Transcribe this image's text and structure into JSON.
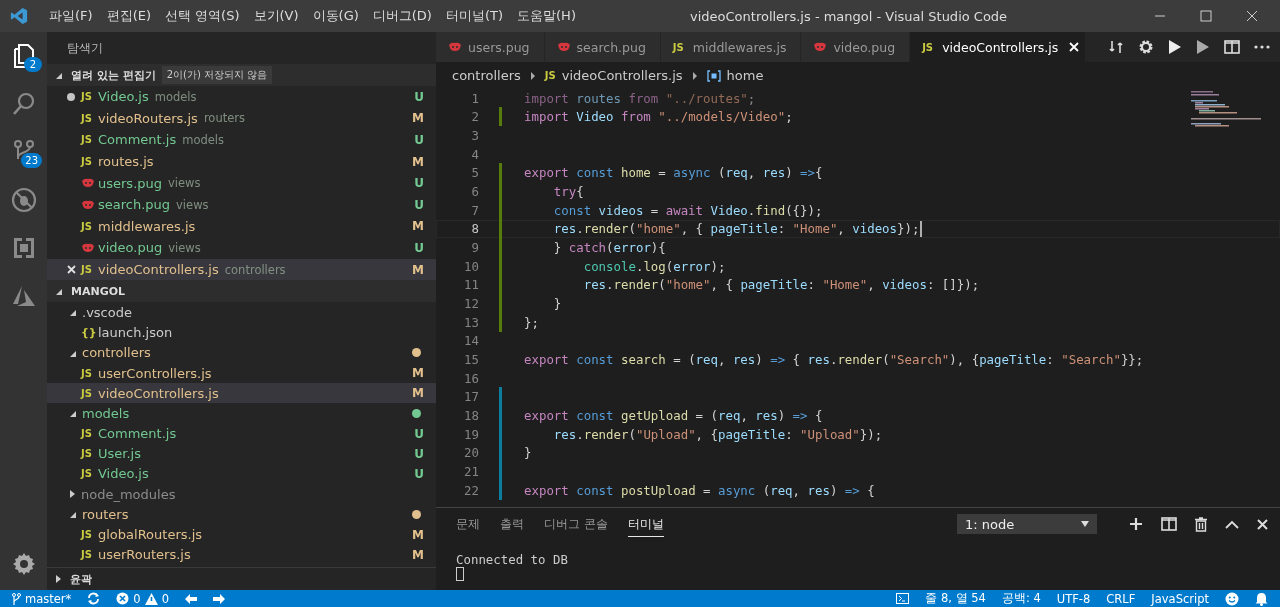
{
  "title_bar": {
    "menu": [
      "파일(F)",
      "편집(E)",
      "선택 영역(S)",
      "보기(V)",
      "이동(G)",
      "디버그(D)",
      "터미널(T)",
      "도움말(H)"
    ],
    "title": "videoControllers.js - mangol - Visual Studio Code"
  },
  "activity_bar": {
    "items": [
      {
        "kind": "files",
        "badge": "2",
        "selected": true
      },
      {
        "kind": "search",
        "selected": false
      },
      {
        "kind": "source-control",
        "badge": "23",
        "selected": false
      },
      {
        "kind": "debug",
        "selected": false
      },
      {
        "kind": "extensions",
        "selected": false
      },
      {
        "kind": "azure",
        "selected": false
      }
    ]
  },
  "sidebar": {
    "title": "탐색기",
    "open_editors": {
      "title": "열려 있는 편집기",
      "expanded": true,
      "note": "2이(가) 저장되지 않음",
      "items": [
        {
          "name": "Video.js",
          "folder": "models",
          "kind": "js",
          "icon_label": "JS",
          "color": "#73c991",
          "status": "U",
          "dirty": true,
          "selected": false
        },
        {
          "name": "videoRouters.js",
          "folder": "routers",
          "kind": "js",
          "icon_label": "JS",
          "color": "#e2c08d",
          "status": "M",
          "dirty": false,
          "selected": false
        },
        {
          "name": "Comment.js",
          "folder": "models",
          "kind": "js",
          "icon_label": "JS",
          "color": "#73c991",
          "status": "U",
          "dirty": false,
          "selected": false
        },
        {
          "name": "routes.js",
          "kind": "js",
          "icon_label": "JS",
          "color": "#e2c08d",
          "status": "M",
          "dirty": false,
          "selected": false
        },
        {
          "name": "users.pug",
          "folder": "views",
          "kind": "pug",
          "color": "#73c991",
          "status": "U",
          "dirty": false,
          "selected": false
        },
        {
          "name": "search.pug",
          "folder": "views",
          "kind": "pug",
          "color": "#73c991",
          "status": "U",
          "dirty": false,
          "selected": false
        },
        {
          "name": "middlewares.js",
          "kind": "js",
          "icon_label": "JS",
          "color": "#e2c08d",
          "status": "M",
          "dirty": false,
          "selected": false
        },
        {
          "name": "video.pug",
          "folder": "views",
          "kind": "pug",
          "color": "#73c991",
          "status": "U",
          "dirty": false,
          "selected": false
        },
        {
          "name": "videoControllers.js",
          "folder": "controllers",
          "kind": "js",
          "icon_label": "JS",
          "color": "#e2c08d",
          "status": "M",
          "dirty": false,
          "selected": true
        }
      ]
    },
    "workspace": {
      "title": "MANGOL",
      "expanded": true,
      "children": [
        {
          "name": ".vscode",
          "kind": "folder",
          "expanded": true,
          "color": "#cccccc",
          "status_dot": false,
          "children": [
            {
              "name": "launch.json",
              "kind": "json",
              "icon_label": "{}",
              "color": "#cccccc",
              "selected": false
            }
          ]
        },
        {
          "name": "controllers",
          "kind": "folder",
          "expanded": true,
          "color": "#e2c08d",
          "status_dot": true,
          "children": [
            {
              "name": "userControllers.js",
              "kind": "js",
              "icon_label": "JS",
              "color": "#e2c08d",
              "status": "M",
              "selected": false
            },
            {
              "name": "videoControllers.js",
              "kind": "js",
              "icon_label": "JS",
              "color": "#e2c08d",
              "status": "M",
              "selected": true
            }
          ]
        },
        {
          "name": "models",
          "kind": "folder",
          "expanded": true,
          "color": "#73c991",
          "status_dot": true,
          "children": [
            {
              "name": "Comment.js",
              "kind": "js",
              "icon_label": "JS",
              "color": "#73c991",
              "status": "U",
              "selected": false
            },
            {
              "name": "User.js",
              "kind": "js",
              "icon_label": "JS",
              "color": "#73c991",
              "status": "U",
              "selected": false
            },
            {
              "name": "Video.js",
              "kind": "js",
              "icon_label": "JS",
              "color": "#73c991",
              "status": "U",
              "selected": false
            }
          ]
        },
        {
          "name": "node_modules",
          "kind": "folder",
          "expanded": false,
          "color": "#8c8c8c",
          "status_dot": false
        },
        {
          "name": "routers",
          "kind": "folder",
          "expanded": true,
          "color": "#e2c08d",
          "status_dot": true,
          "children": [
            {
              "name": "globalRouters.js",
              "kind": "js",
              "icon_label": "JS",
              "color": "#e2c08d",
              "status": "M",
              "selected": false
            },
            {
              "name": "userRouters.js",
              "kind": "js",
              "icon_label": "JS",
              "color": "#e2c08d",
              "status": "M",
              "selected": false
            }
          ]
        }
      ]
    },
    "outline": {
      "title": "윤곽",
      "expanded": false
    }
  },
  "editor": {
    "tabs": [
      {
        "label": "users.pug",
        "kind": "pug",
        "selected": false
      },
      {
        "label": "search.pug",
        "kind": "pug",
        "selected": false
      },
      {
        "label": "middlewares.js",
        "kind": "js",
        "icon_label": "JS",
        "selected": false
      },
      {
        "label": "video.pug",
        "kind": "pug",
        "selected": false
      },
      {
        "label": "videoControllers.js",
        "kind": "js",
        "icon_label": "JS",
        "selected": true
      }
    ],
    "breadcrumb": {
      "folder": "controllers",
      "file": "videoControllers.js",
      "file_icon_label": "JS",
      "symbol": "home"
    },
    "lines": [
      {
        "number": "1",
        "faded": true,
        "tokens": [
          {
            "text": "import",
            "kind": "kw"
          },
          {
            "text": " routes",
            "kind": "var"
          },
          {
            "text": " from",
            "kind": "kw"
          },
          {
            "text": " \"../routes\"",
            "kind": "str"
          },
          {
            "text": ";",
            "kind": "p"
          }
        ]
      },
      {
        "number": "2",
        "kind": "added",
        "tokens": [
          {
            "text": "import",
            "kind": "kw"
          },
          {
            "text": " Video",
            "kind": "var"
          },
          {
            "text": " from",
            "kind": "kw"
          },
          {
            "text": " \"../models/Video\"",
            "kind": "str"
          },
          {
            "text": ";",
            "kind": "p"
          }
        ]
      },
      {
        "number": "3"
      },
      {
        "number": "4"
      },
      {
        "number": "5",
        "kind": "added",
        "tokens": [
          {
            "text": "export",
            "kind": "kw"
          },
          {
            "text": " const",
            "kind": "st"
          },
          {
            "text": " home",
            "kind": "fn"
          },
          {
            "text": " =",
            "kind": "p"
          },
          {
            "text": " async",
            "kind": "st"
          },
          {
            "text": " (",
            "kind": "p"
          },
          {
            "text": "req",
            "kind": "var"
          },
          {
            "text": ", ",
            "kind": "p"
          },
          {
            "text": "res",
            "kind": "var"
          },
          {
            "text": ") ",
            "kind": "p"
          },
          {
            "text": "=>",
            "kind": "st"
          },
          {
            "text": "{",
            "kind": "p"
          }
        ]
      },
      {
        "number": "6",
        "kind": "added",
        "tokens": [
          {
            "text": "    try",
            "kind": "kw"
          },
          {
            "text": "{",
            "kind": "p"
          }
        ]
      },
      {
        "number": "7",
        "kind": "added",
        "tokens": [
          {
            "text": "    const",
            "kind": "st"
          },
          {
            "text": " videos",
            "kind": "var"
          },
          {
            "text": " =",
            "kind": "p"
          },
          {
            "text": " await",
            "kind": "kw"
          },
          {
            "text": " Video",
            "kind": "var"
          },
          {
            "text": ".",
            "kind": "p"
          },
          {
            "text": "find",
            "kind": "fn"
          },
          {
            "text": "({});",
            "kind": "p"
          }
        ]
      },
      {
        "number": "8",
        "kind": "added",
        "current": true,
        "tokens": [
          {
            "text": "    res",
            "kind": "var"
          },
          {
            "text": ".",
            "kind": "p"
          },
          {
            "text": "render",
            "kind": "fn"
          },
          {
            "text": "(",
            "kind": "p"
          },
          {
            "text": "\"home\"",
            "kind": "str"
          },
          {
            "text": ", { ",
            "kind": "p"
          },
          {
            "text": "pageTitle",
            "kind": "var"
          },
          {
            "text": ": ",
            "kind": "p"
          },
          {
            "text": "\"Home\"",
            "kind": "str"
          },
          {
            "text": ", ",
            "kind": "p"
          },
          {
            "text": "videos",
            "kind": "var"
          },
          {
            "text": "});",
            "kind": "p"
          }
        ]
      },
      {
        "number": "9",
        "kind": "added",
        "tokens": [
          {
            "text": "    } ",
            "kind": "p"
          },
          {
            "text": "catch",
            "kind": "kw"
          },
          {
            "text": "(",
            "kind": "p"
          },
          {
            "text": "error",
            "kind": "var"
          },
          {
            "text": "){",
            "kind": "p"
          }
        ]
      },
      {
        "number": "10",
        "kind": "added",
        "tokens": [
          {
            "text": "        console",
            "kind": "cls"
          },
          {
            "text": ".",
            "kind": "p"
          },
          {
            "text": "log",
            "kind": "fn"
          },
          {
            "text": "(",
            "kind": "p"
          },
          {
            "text": "error",
            "kind": "var"
          },
          {
            "text": ");",
            "kind": "p"
          }
        ]
      },
      {
        "number": "11",
        "kind": "added",
        "tokens": [
          {
            "text": "        res",
            "kind": "var"
          },
          {
            "text": ".",
            "kind": "p"
          },
          {
            "text": "render",
            "kind": "fn"
          },
          {
            "text": "(",
            "kind": "p"
          },
          {
            "text": "\"home\"",
            "kind": "str"
          },
          {
            "text": ", { ",
            "kind": "p"
          },
          {
            "text": "pageTitle",
            "kind": "var"
          },
          {
            "text": ": ",
            "kind": "p"
          },
          {
            "text": "\"Home\"",
            "kind": "str"
          },
          {
            "text": ", ",
            "kind": "p"
          },
          {
            "text": "videos",
            "kind": "var"
          },
          {
            "text": ": []});",
            "kind": "p"
          }
        ]
      },
      {
        "number": "12",
        "kind": "added",
        "tokens": [
          {
            "text": "    }",
            "kind": "p"
          }
        ]
      },
      {
        "number": "13",
        "kind": "added",
        "tokens": [
          {
            "text": "};",
            "kind": "p"
          }
        ]
      },
      {
        "number": "14"
      },
      {
        "number": "15",
        "tokens": [
          {
            "text": "export",
            "kind": "kw"
          },
          {
            "text": " const",
            "kind": "st"
          },
          {
            "text": " search",
            "kind": "fn"
          },
          {
            "text": " = (",
            "kind": "p"
          },
          {
            "text": "req",
            "kind": "var"
          },
          {
            "text": ", ",
            "kind": "p"
          },
          {
            "text": "res",
            "kind": "var"
          },
          {
            "text": ") ",
            "kind": "p"
          },
          {
            "text": "=>",
            "kind": "st"
          },
          {
            "text": " { ",
            "kind": "p"
          },
          {
            "text": "res",
            "kind": "var"
          },
          {
            "text": ".",
            "kind": "p"
          },
          {
            "text": "render",
            "kind": "fn"
          },
          {
            "text": "(",
            "kind": "p"
          },
          {
            "text": "\"Search\"",
            "kind": "str"
          },
          {
            "text": "), {",
            "kind": "p"
          },
          {
            "text": "pageTitle",
            "kind": "var"
          },
          {
            "text": ": ",
            "kind": "p"
          },
          {
            "text": "\"Search\"",
            "kind": "str"
          },
          {
            "text": "}};",
            "kind": "p"
          }
        ]
      },
      {
        "number": "16"
      },
      {
        "number": "17",
        "kind": "modified"
      },
      {
        "number": "18",
        "kind": "modified",
        "tokens": [
          {
            "text": "export",
            "kind": "kw"
          },
          {
            "text": " const",
            "kind": "st"
          },
          {
            "text": " getUpload",
            "kind": "fn"
          },
          {
            "text": " = (",
            "kind": "p"
          },
          {
            "text": "req",
            "kind": "var"
          },
          {
            "text": ", ",
            "kind": "p"
          },
          {
            "text": "res",
            "kind": "var"
          },
          {
            "text": ") ",
            "kind": "p"
          },
          {
            "text": "=>",
            "kind": "st"
          },
          {
            "text": " {",
            "kind": "p"
          }
        ]
      },
      {
        "number": "19",
        "kind": "modified",
        "tokens": [
          {
            "text": "    res",
            "kind": "var"
          },
          {
            "text": ".",
            "kind": "p"
          },
          {
            "text": "render",
            "kind": "fn"
          },
          {
            "text": "(",
            "kind": "p"
          },
          {
            "text": "\"Upload\"",
            "kind": "str"
          },
          {
            "text": ", {",
            "kind": "p"
          },
          {
            "text": "pageTitle",
            "kind": "var"
          },
          {
            "text": ": ",
            "kind": "p"
          },
          {
            "text": "\"Upload\"",
            "kind": "str"
          },
          {
            "text": "});",
            "kind": "p"
          }
        ]
      },
      {
        "number": "20",
        "kind": "modified",
        "tokens": [
          {
            "text": "}",
            "kind": "p"
          }
        ]
      },
      {
        "number": "21",
        "kind": "modified"
      },
      {
        "number": "22",
        "kind": "modified",
        "tokens": [
          {
            "text": "export",
            "kind": "kw"
          },
          {
            "text": " const",
            "kind": "st"
          },
          {
            "text": " postUpload",
            "kind": "fn"
          },
          {
            "text": " =",
            "kind": "p"
          },
          {
            "text": " async",
            "kind": "st"
          },
          {
            "text": " (",
            "kind": "p"
          },
          {
            "text": "req",
            "kind": "var"
          },
          {
            "text": ", ",
            "kind": "p"
          },
          {
            "text": "res",
            "kind": "var"
          },
          {
            "text": ") ",
            "kind": "p"
          },
          {
            "text": "=>",
            "kind": "st"
          },
          {
            "text": " {",
            "kind": "p"
          }
        ]
      }
    ]
  },
  "panel": {
    "tabs": [
      {
        "label": "문제",
        "selected": false
      },
      {
        "label": "출력",
        "selected": false
      },
      {
        "label": "디버그 콘솔",
        "selected": false
      },
      {
        "label": "터미널",
        "selected": true
      }
    ],
    "terminal_select": "1: node",
    "output": "Connected to DB"
  },
  "status_bar": {
    "branch": "master*",
    "errors": "0",
    "warnings": "0",
    "position": "줄 8, 열 54",
    "indent": "공백: 4",
    "encoding": "UTF-8",
    "eol": "CRLF",
    "language": "JavaScript"
  }
}
